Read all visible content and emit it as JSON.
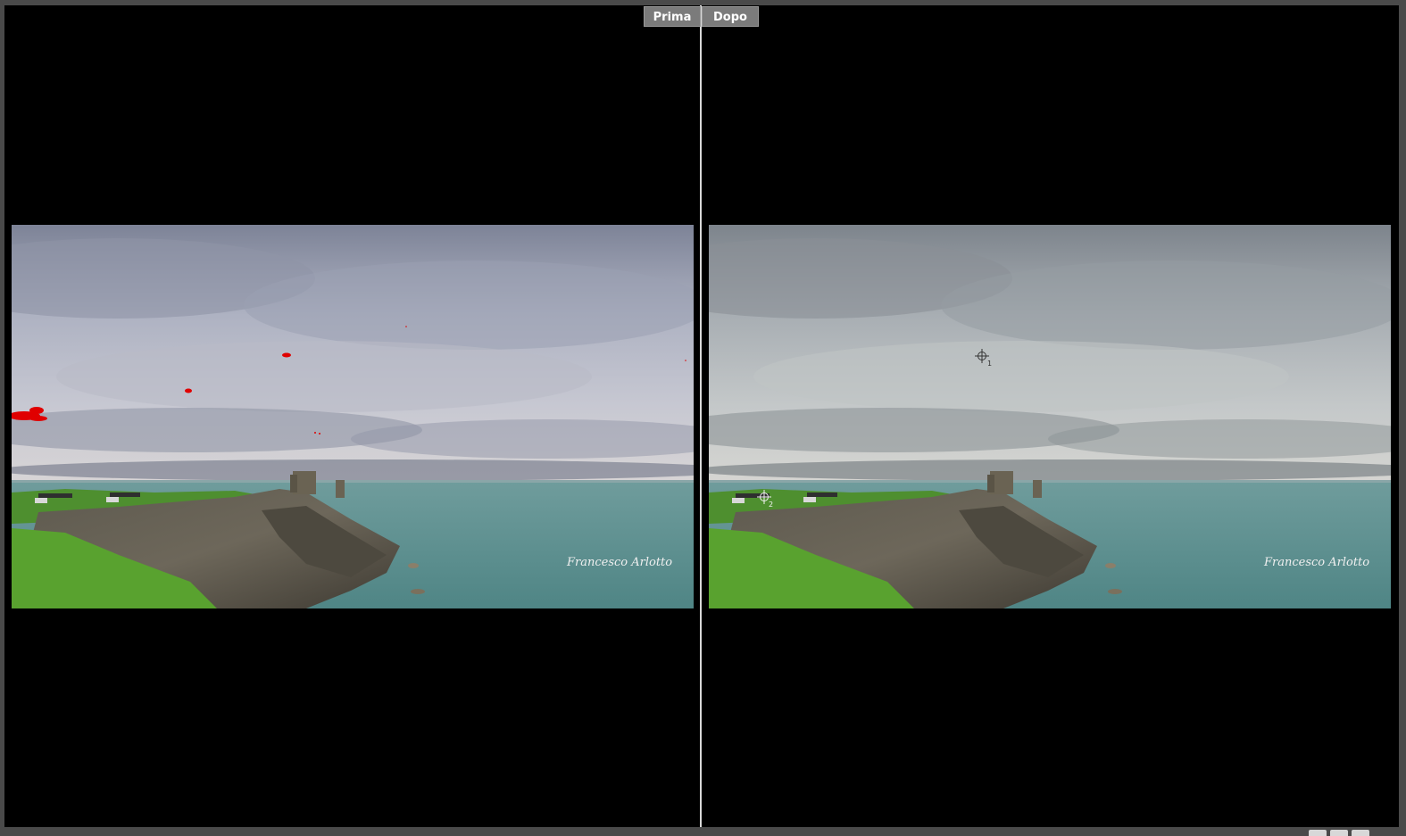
{
  "tabs": {
    "before_label": "Prima",
    "after_label": "Dopo"
  },
  "watermark": "Francesco Arlotto",
  "markers": [
    {
      "label": "1"
    },
    {
      "label": "2"
    }
  ],
  "colors": {
    "background": "#000000",
    "frame": "#4a4a4a",
    "divider": "#d9d9d9",
    "tab_bg": "#7b7b7b",
    "clipping_highlight": "#e00000"
  },
  "icons": {
    "marker": "crosshair-icon"
  }
}
